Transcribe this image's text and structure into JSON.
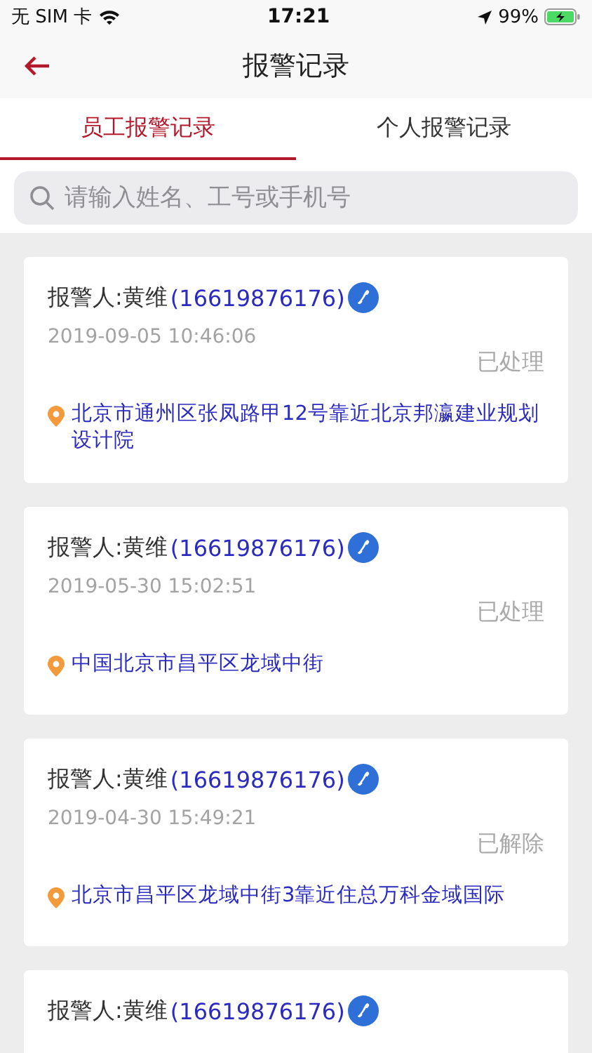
{
  "status_bar": {
    "carrier": "无 SIM 卡",
    "time": "17:21",
    "battery": "99%"
  },
  "nav": {
    "title": "报警记录"
  },
  "tabs": [
    {
      "label": "员工报警记录",
      "selected": true
    },
    {
      "label": "个人报警记录",
      "selected": false
    }
  ],
  "search": {
    "placeholder": "请输入姓名、工号或手机号"
  },
  "records": [
    {
      "reporter": "报警人:黄维",
      "phone": "(16619876176)",
      "time": "2019-09-05 10:46:06",
      "status": "已处理",
      "address": "北京市通州区张凤路甲12号靠近北京邦瀛建业规划设计院"
    },
    {
      "reporter": "报警人:黄维",
      "phone": "(16619876176)",
      "time": "2019-05-30 15:02:51",
      "status": "已处理",
      "address": "中国北京市昌平区龙域中街"
    },
    {
      "reporter": "报警人:黄维",
      "phone": "(16619876176)",
      "time": "2019-04-30 15:49:21",
      "status": "已解除",
      "address": "北京市昌平区龙域中街3靠近住总万科金域国际"
    },
    {
      "reporter": "报警人:黄维",
      "phone": "(16619876176)"
    }
  ]
}
